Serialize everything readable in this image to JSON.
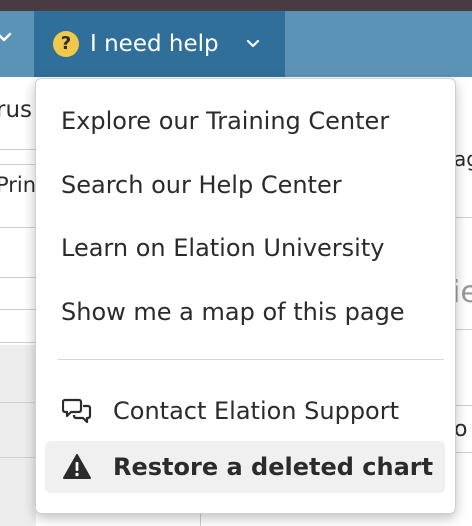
{
  "nav": {
    "help_label": "I need help"
  },
  "background": {
    "frag_trus": "rus",
    "frag_print": "Prin",
    "frag_ag": "ag",
    "frag_ie": "ie",
    "frag_o": "o"
  },
  "help_menu": {
    "items": [
      {
        "label": "Explore our Training Center"
      },
      {
        "label": "Search our Help Center"
      },
      {
        "label": "Learn on Elation University"
      },
      {
        "label": "Show me a map of this page"
      }
    ],
    "support": {
      "label": "Contact Elation Support",
      "icon": "chat-bubbles-icon"
    },
    "restore": {
      "label": "Restore a deleted chart",
      "icon": "warning-triangle-icon"
    }
  },
  "colors": {
    "nav_bg": "#5b93b7",
    "help_tab_bg": "#2f6f99",
    "help_icon": "#f0c94a",
    "top_strip": "#4a3a42"
  }
}
